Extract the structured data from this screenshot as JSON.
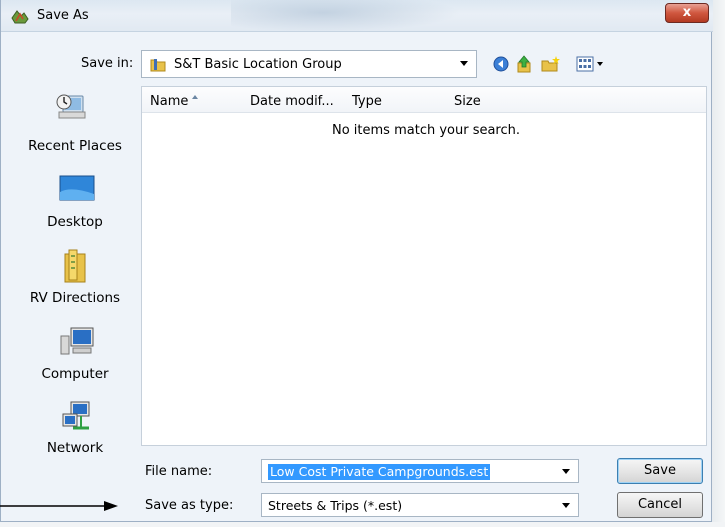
{
  "window": {
    "title": "Save As",
    "close_label": "x"
  },
  "save_in": {
    "label": "Save in:",
    "value": "S&T Basic Location Group"
  },
  "toolbar": {
    "icons": [
      "back-icon",
      "up-folder-icon",
      "new-folder-icon",
      "views-menu-icon"
    ]
  },
  "places": [
    {
      "label": "Recent Places",
      "icon": "recent-places-icon"
    },
    {
      "label": "Desktop",
      "icon": "desktop-icon"
    },
    {
      "label": "RV Directions",
      "icon": "folder-icon"
    },
    {
      "label": "Computer",
      "icon": "computer-icon"
    },
    {
      "label": "Network",
      "icon": "network-icon"
    }
  ],
  "file_list": {
    "columns": [
      "Name",
      "Date modif...",
      "Type",
      "Size"
    ],
    "empty_message": "No items match your search."
  },
  "file_name": {
    "label": "File name:",
    "value": "Low Cost Private Campgrounds.est"
  },
  "save_as_type": {
    "label": "Save as type:",
    "value": "Streets & Trips (*.est)"
  },
  "buttons": {
    "save": "Save",
    "cancel": "Cancel"
  },
  "colors": {
    "selection": "#3399ff",
    "dialog_bg": "#eef3f9",
    "close_button": "#c94a33"
  }
}
